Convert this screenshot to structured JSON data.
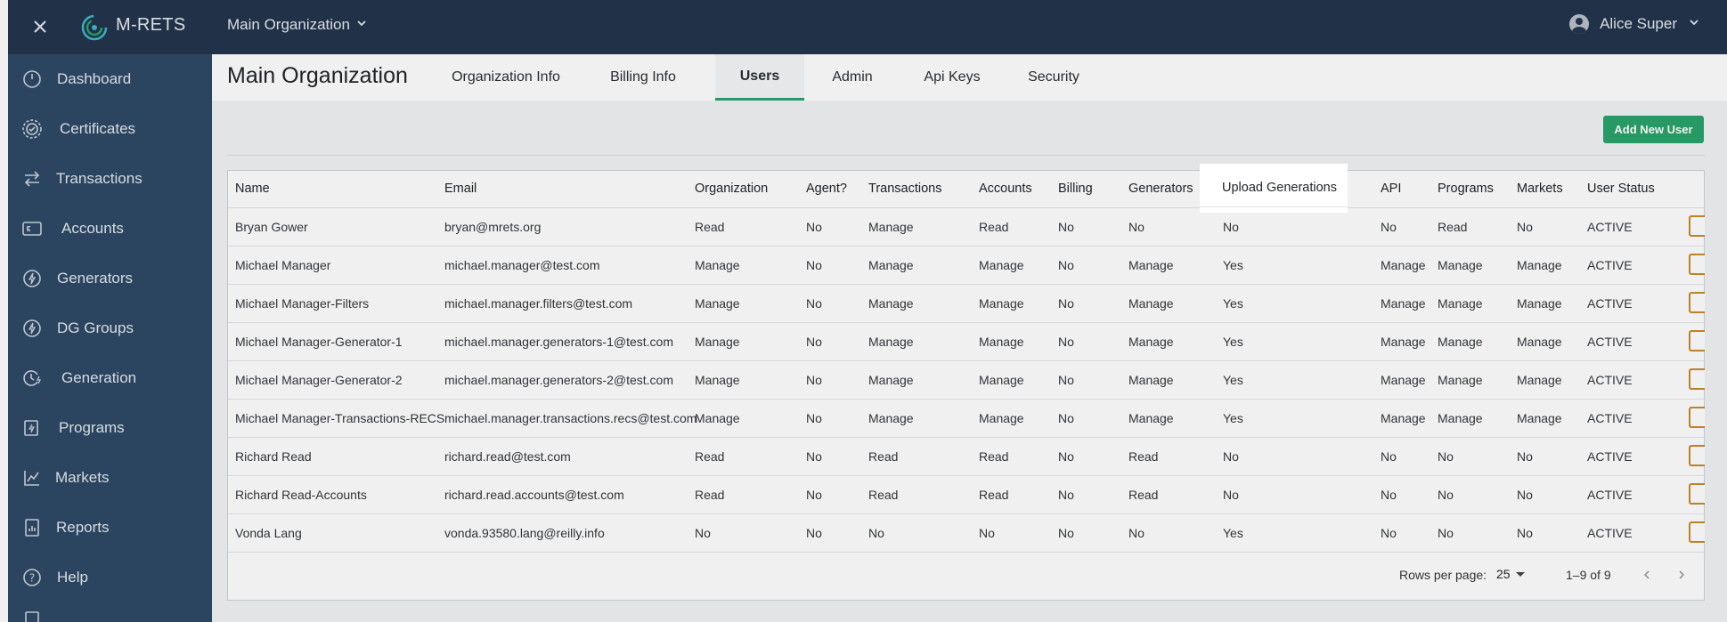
{
  "topbar": {
    "brand": "M-RETS",
    "org_selector": "Main Organization",
    "user_name": "Alice Super"
  },
  "sidebar": {
    "items": [
      {
        "label": "Dashboard",
        "icon": "dashboard-icon"
      },
      {
        "label": "Certificates",
        "icon": "certificate-icon"
      },
      {
        "label": "Transactions",
        "icon": "transfer-arrows-icon"
      },
      {
        "label": "Accounts",
        "icon": "account-card-icon"
      },
      {
        "label": "Generators",
        "icon": "lightning-icon"
      },
      {
        "label": "DG Groups",
        "icon": "dg-group-icon"
      },
      {
        "label": "Generation",
        "icon": "generation-clock-icon"
      },
      {
        "label": "Programs",
        "icon": "program-doc-icon"
      },
      {
        "label": "Markets",
        "icon": "market-chart-icon"
      },
      {
        "label": "Reports",
        "icon": "report-icon"
      },
      {
        "label": "Help",
        "icon": "help-icon"
      }
    ]
  },
  "header": {
    "title": "Main Organization",
    "tabs": [
      {
        "label": "Organization Info",
        "active": false
      },
      {
        "label": "Billing Info",
        "active": false
      },
      {
        "label": "Users",
        "active": true
      },
      {
        "label": "Admin",
        "active": false
      },
      {
        "label": "Api Keys",
        "active": false
      },
      {
        "label": "Security",
        "active": false
      }
    ]
  },
  "actions": {
    "add_user": "Add New User"
  },
  "table": {
    "columns": [
      "Name",
      "Email",
      "Organization",
      "Agent?",
      "Transactions",
      "Accounts",
      "Billing",
      "Generators",
      "Upload Generations",
      "API",
      "Programs",
      "Markets",
      "User Status"
    ],
    "rows": [
      [
        "Bryan Gower",
        "bryan@mrets.org",
        "Read",
        "No",
        "Manage",
        "Read",
        "No",
        "No",
        "No",
        "No",
        "Read",
        "No",
        "ACTIVE"
      ],
      [
        "Michael Manager",
        "michael.manager@test.com",
        "Manage",
        "No",
        "Manage",
        "Manage",
        "No",
        "Manage",
        "Yes",
        "Manage",
        "Manage",
        "Manage",
        "ACTIVE"
      ],
      [
        "Michael Manager-Filters",
        "michael.manager.filters@test.com",
        "Manage",
        "No",
        "Manage",
        "Manage",
        "No",
        "Manage",
        "Yes",
        "Manage",
        "Manage",
        "Manage",
        "ACTIVE"
      ],
      [
        "Michael Manager-Generator-1",
        "michael.manager.generators-1@test.com",
        "Manage",
        "No",
        "Manage",
        "Manage",
        "No",
        "Manage",
        "Yes",
        "Manage",
        "Manage",
        "Manage",
        "ACTIVE"
      ],
      [
        "Michael Manager-Generator-2",
        "michael.manager.generators-2@test.com",
        "Manage",
        "No",
        "Manage",
        "Manage",
        "No",
        "Manage",
        "Yes",
        "Manage",
        "Manage",
        "Manage",
        "ACTIVE"
      ],
      [
        "Michael Manager-Transactions-RECS",
        "michael.manager.transactions.recs@test.com",
        "Manage",
        "No",
        "Manage",
        "Manage",
        "No",
        "Manage",
        "Yes",
        "Manage",
        "Manage",
        "Manage",
        "ACTIVE"
      ],
      [
        "Richard Read",
        "richard.read@test.com",
        "Read",
        "No",
        "Read",
        "Read",
        "No",
        "Read",
        "No",
        "No",
        "No",
        "No",
        "ACTIVE"
      ],
      [
        "Richard Read-Accounts",
        "richard.read.accounts@test.com",
        "Read",
        "No",
        "Read",
        "Read",
        "No",
        "Read",
        "No",
        "No",
        "No",
        "No",
        "ACTIVE"
      ],
      [
        "Vonda Lang",
        "vonda.93580.lang@reilly.info",
        "No",
        "No",
        "No",
        "No",
        "No",
        "No",
        "Yes",
        "No",
        "No",
        "No",
        "ACTIVE"
      ]
    ]
  },
  "pagination": {
    "rows_per_page_label": "Rows per page:",
    "rows_per_page": "25",
    "range": "1–9 of 9"
  },
  "colors": {
    "topbar": "#24364d",
    "sidebar": "#2e4a66",
    "accent": "#2aa36b"
  }
}
